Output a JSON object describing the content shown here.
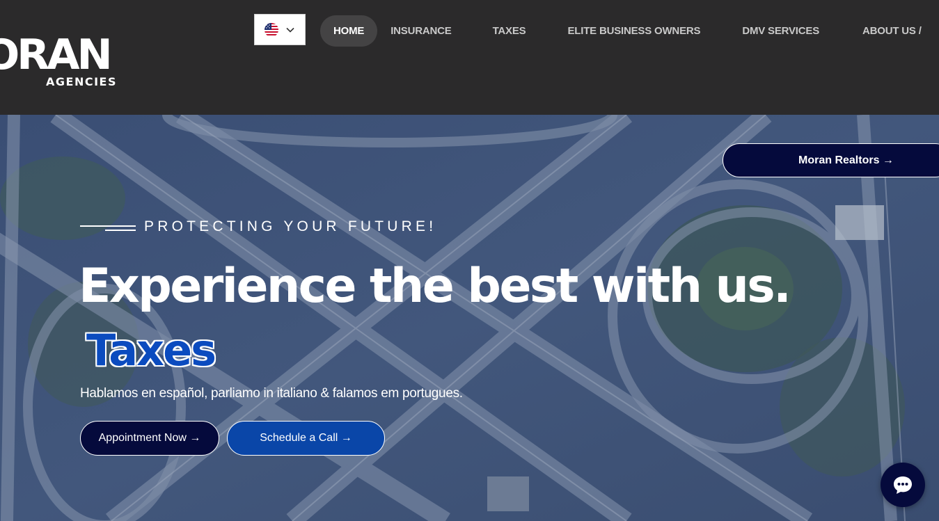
{
  "brand": {
    "logo_main": "ORAN",
    "logo_sub": "AGENCIES"
  },
  "language_selector": {
    "icon": "us-flag-icon",
    "dropdown_icon": "chevron-down-icon"
  },
  "nav": {
    "items": [
      {
        "label": "HOME",
        "active": true
      },
      {
        "label": "INSURANCE",
        "active": false
      },
      {
        "label": "TAXES",
        "active": false
      },
      {
        "label": "ELITE BUSINESS OWNERS",
        "active": false
      },
      {
        "label": "DMV SERVICES",
        "active": false
      },
      {
        "label": "ABOUT US /",
        "active": false
      }
    ]
  },
  "hero": {
    "realtors_button": "Moran Realtors →",
    "tagline": "PROTECTING YOUR FUTURE!",
    "headline": "Experience the best with us.",
    "rotating_word": "Taxes",
    "languages": "Hablamos en español, parliamo in italiano & falamos em portugues.",
    "primary_button": "Appointment Now →",
    "secondary_button": "Schedule a Call →"
  },
  "chat": {
    "icon": "chat-bubble-icon"
  },
  "colors": {
    "header_bg": "#2b2a2b",
    "navy": "#050a3c",
    "blue": "#0a46a8",
    "hero_overlay": "#3e5378"
  }
}
